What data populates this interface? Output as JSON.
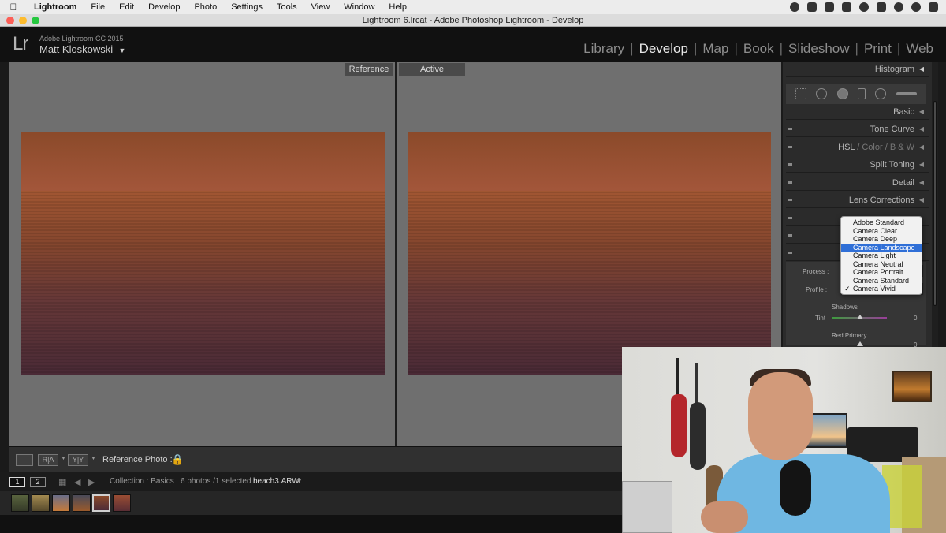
{
  "menubar": {
    "app": "Lightroom",
    "items": [
      "File",
      "Edit",
      "Develop",
      "Photo",
      "Settings",
      "Tools",
      "View",
      "Window",
      "Help"
    ]
  },
  "window": {
    "title": "Lightroom 6.lrcat - Adobe Photoshop Lightroom - Develop"
  },
  "header": {
    "logo": "Lr",
    "product": "Adobe Lightroom CC 2015",
    "user": "Matt Kloskowski",
    "user_caret": "▼",
    "modules": [
      "Library",
      "Develop",
      "Map",
      "Book",
      "Slideshow",
      "Print",
      "Web"
    ],
    "active_module": "Develop"
  },
  "compare": {
    "reference_label": "Reference",
    "active_label": "Active"
  },
  "panels": {
    "histogram": "Histogram",
    "basic": "Basic",
    "tone_curve": "Tone Curve",
    "hsl": {
      "a": "HSL",
      "b": "Color",
      "c": "B & W",
      "sep": "/"
    },
    "split_toning": "Split Toning",
    "detail": "Detail",
    "lens_corrections": "Lens Corrections",
    "camera_calibration": {
      "process_label": "Process :",
      "profile_label": "Profile :",
      "shadows_label": "Shadows",
      "tint_label": "Tint",
      "tint_value": "0",
      "red_primary_label": "Red Primary",
      "red_primary_value": "0"
    }
  },
  "profile_dropdown": {
    "options": [
      "Adobe Standard",
      "Camera Clear",
      "Camera Deep",
      "Camera Landscape",
      "Camera Light",
      "Camera Neutral",
      "Camera Portrait",
      "Camera Standard",
      "Camera Vivid"
    ],
    "highlighted": "Camera Landscape",
    "checked": "Camera Vivid",
    "check_mark": "✓"
  },
  "toolbar": {
    "btn_ra": "R|A",
    "btn_yy": "Y|Y",
    "reference_photo_label": "Reference Photo :",
    "lock_icon": "🔒"
  },
  "filmstrip_bar": {
    "monitor1": "1",
    "monitor2": "2",
    "collection": "Collection : Basics",
    "count": "6 photos /1 selected /",
    "filename": "beach3.ARW",
    "filename_caret": "▾"
  },
  "colors": {
    "accent_selected": "#2f6fd7",
    "active_module": "#e8e8e8",
    "inactive_module": "#8d8d8d"
  }
}
